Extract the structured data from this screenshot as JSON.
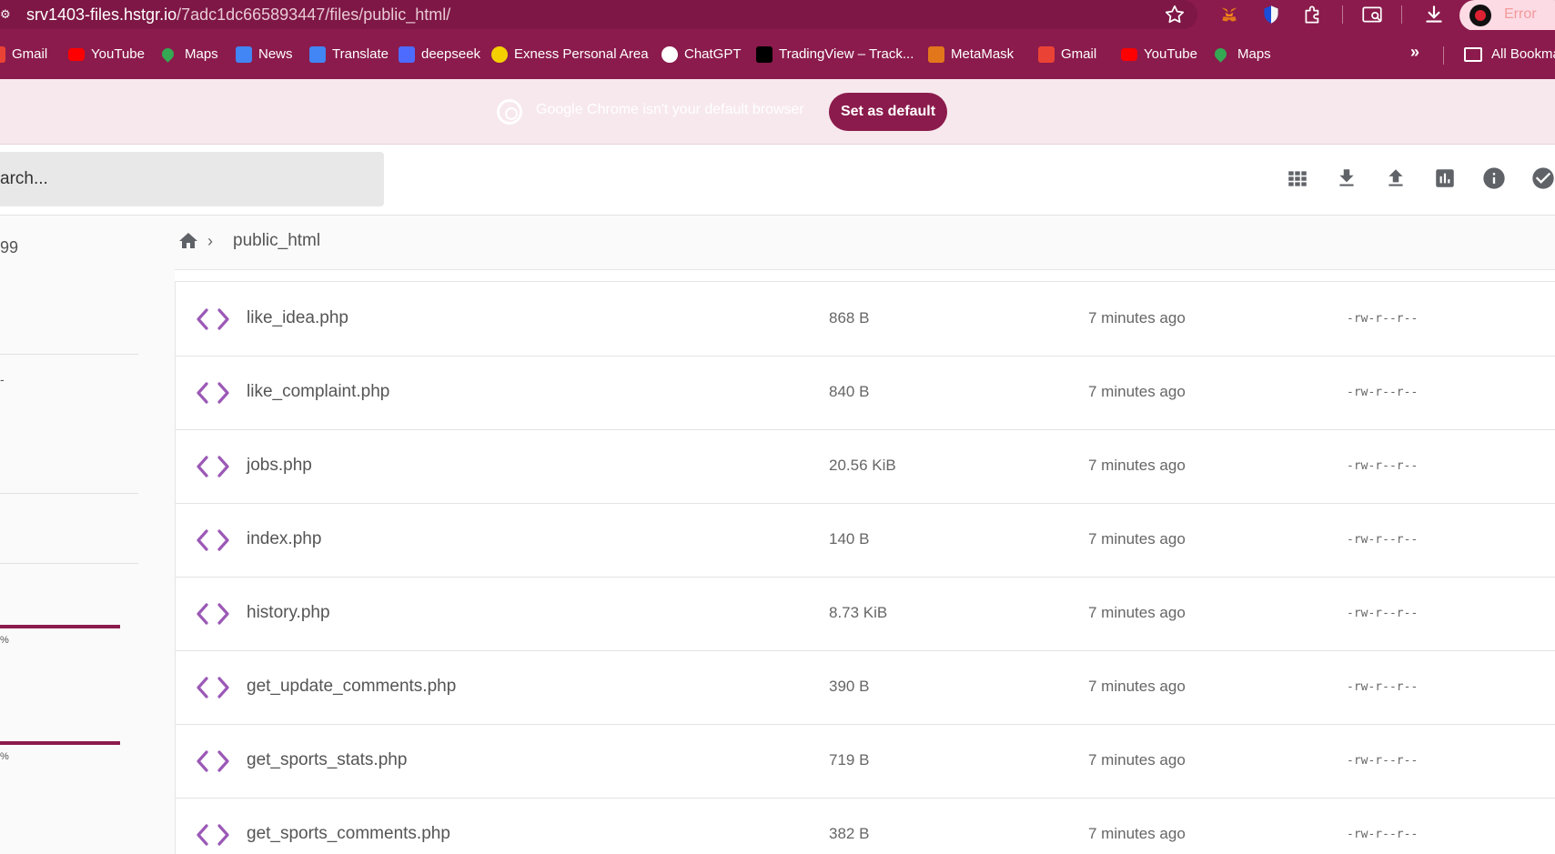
{
  "browser": {
    "url_host": "srv1403-files.hstgr.io",
    "url_path": "/7adc1dc665893447/files/public_html/",
    "profile_status": "Error",
    "bookmarks": [
      {
        "label": "Gmail",
        "icon": "gmail-icon",
        "color": "#EA4335"
      },
      {
        "label": "YouTube",
        "icon": "youtube-icon",
        "color": "#FF0000"
      },
      {
        "label": "Maps",
        "icon": "maps-icon",
        "color": "#34A853"
      },
      {
        "label": "News",
        "icon": "news-icon",
        "color": "#4285F4"
      },
      {
        "label": "Translate",
        "icon": "translate-icon",
        "color": "#4285F4"
      },
      {
        "label": "deepseek",
        "icon": "deepseek-icon",
        "color": "#4D6BFE"
      },
      {
        "label": "Exness Personal Area",
        "icon": "exness-icon",
        "color": "#F5D000"
      },
      {
        "label": "ChatGPT",
        "icon": "chatgpt-icon",
        "color": "#FFFFFF"
      },
      {
        "label": "TradingView – Track...",
        "icon": "tradingview-icon",
        "color": "#000000"
      },
      {
        "label": "MetaMask",
        "icon": "metamask-icon",
        "color": "#E2761B"
      },
      {
        "label": "Gmail",
        "icon": "gmail-icon",
        "color": "#EA4335"
      },
      {
        "label": "YouTube",
        "icon": "youtube-icon",
        "color": "#FF0000"
      },
      {
        "label": "Maps",
        "icon": "maps-icon",
        "color": "#34A853"
      }
    ],
    "all_bookmarks_label": "All Bookma"
  },
  "banner": {
    "message": "Google Chrome isn't your default browser",
    "button_label": "Set as default"
  },
  "header": {
    "search_placeholder": "arch..."
  },
  "sidebar": {
    "counter_text": "99",
    "dash_text": "-",
    "progress": [
      {
        "label": "%",
        "fill": 1.0
      },
      {
        "label": "%",
        "fill": 1.0
      }
    ]
  },
  "breadcrumb": {
    "current": "public_html"
  },
  "files": [
    {
      "name": "like_idea.php",
      "size": "868 B",
      "modified": "7 minutes ago",
      "perm": "-rw-r--r--"
    },
    {
      "name": "like_complaint.php",
      "size": "840 B",
      "modified": "7 minutes ago",
      "perm": "-rw-r--r--"
    },
    {
      "name": "jobs.php",
      "size": "20.56 KiB",
      "modified": "7 minutes ago",
      "perm": "-rw-r--r--"
    },
    {
      "name": "index.php",
      "size": "140 B",
      "modified": "7 minutes ago",
      "perm": "-rw-r--r--"
    },
    {
      "name": "history.php",
      "size": "8.73 KiB",
      "modified": "7 minutes ago",
      "perm": "-rw-r--r--"
    },
    {
      "name": "get_update_comments.php",
      "size": "390 B",
      "modified": "7 minutes ago",
      "perm": "-rw-r--r--"
    },
    {
      "name": "get_sports_stats.php",
      "size": "719 B",
      "modified": "7 minutes ago",
      "perm": "-rw-r--r--"
    },
    {
      "name": "get_sports_comments.php",
      "size": "382 B",
      "modified": "7 minutes ago",
      "perm": "-rw-r--r--"
    }
  ],
  "colors": {
    "brand": "#8b1b4c",
    "code_icon": "#9b59b6"
  }
}
